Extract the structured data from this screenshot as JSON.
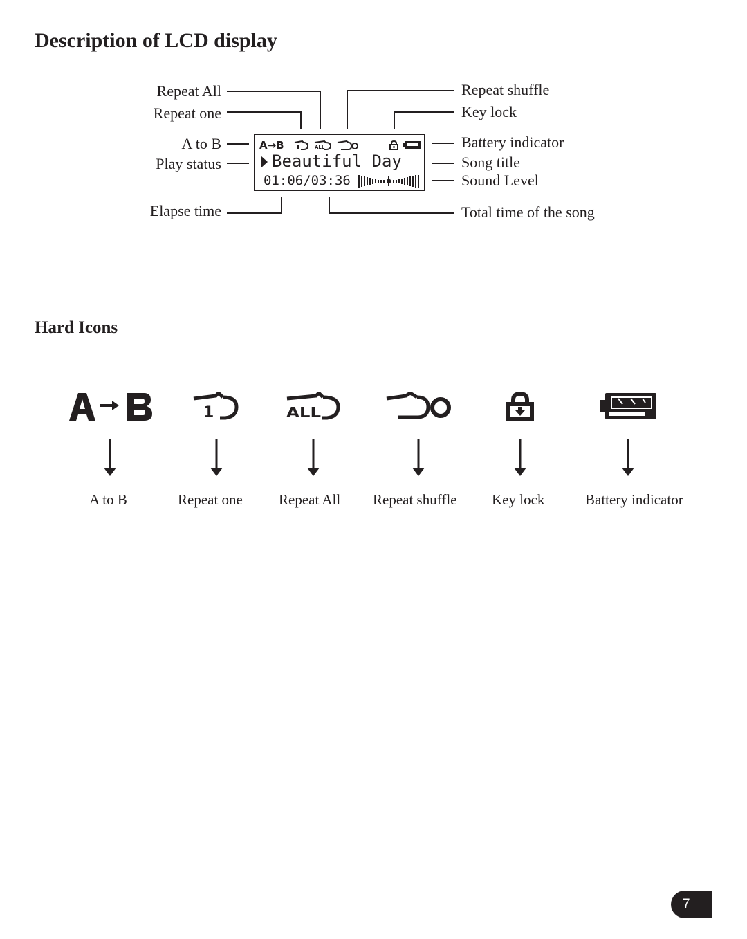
{
  "page": {
    "title": "Description of LCD display",
    "section_title": "Hard Icons",
    "page_number": "7"
  },
  "lcd_diagram": {
    "screen": {
      "status_row_text": "A→B",
      "play_indicator": "play-triangle-icon",
      "song_title": "Beautiful Day",
      "elapsed_time": "01:06",
      "separator": "/",
      "total_time": "03:36",
      "sound_level_icon": "equalizer-bars-icon"
    },
    "left_callouts": [
      {
        "label": "Repeat All"
      },
      {
        "label": "Repeat one"
      },
      {
        "label": "A to B"
      },
      {
        "label": "Play status"
      },
      {
        "label": "Elapse time"
      }
    ],
    "right_callouts": [
      {
        "label": "Repeat shuffle"
      },
      {
        "label": "Key lock"
      },
      {
        "label": "Battery indicator"
      },
      {
        "label": "Song title"
      },
      {
        "label": "Sound Level"
      },
      {
        "label": "Total time of the song"
      }
    ]
  },
  "hard_icons": [
    {
      "icon": "a-to-b-icon",
      "label": "A to B"
    },
    {
      "icon": "repeat-one-icon",
      "label": "Repeat one"
    },
    {
      "icon": "repeat-all-icon",
      "label": "Repeat All"
    },
    {
      "icon": "repeat-shuffle-icon",
      "label": "Repeat shuffle"
    },
    {
      "icon": "key-lock-icon",
      "label": "Key lock"
    },
    {
      "icon": "battery-indicator-icon",
      "label": "Battery indicator"
    }
  ]
}
